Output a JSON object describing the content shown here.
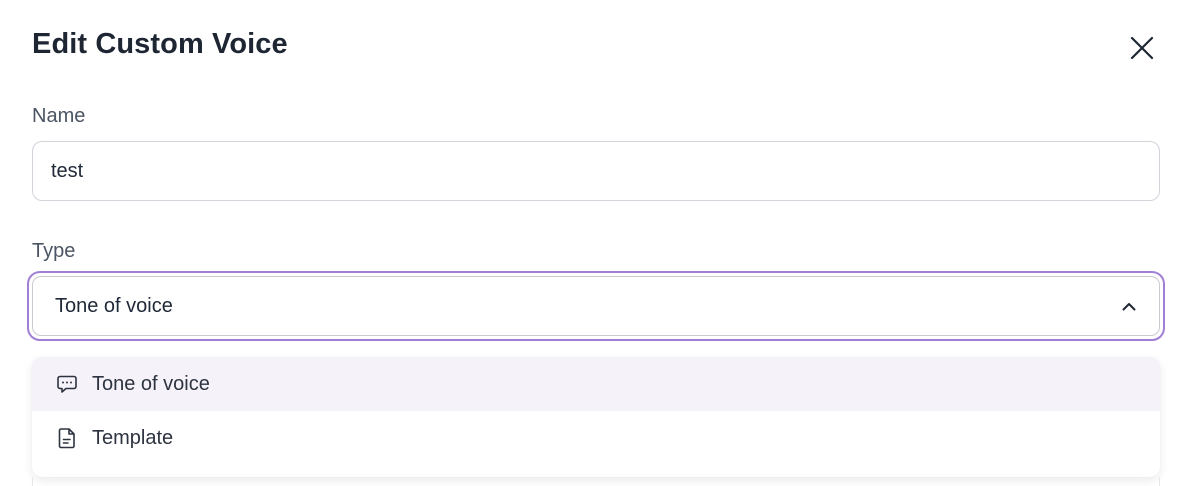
{
  "modal": {
    "title": "Edit Custom Voice",
    "close_icon": "close-icon"
  },
  "name_field": {
    "label": "Name",
    "value": "test"
  },
  "type_field": {
    "label": "Type",
    "selected": "Tone of voice",
    "chevron_icon": "chevron-up-icon",
    "focus_color": "#a07fd4",
    "options": [
      {
        "label": "Tone of voice",
        "icon": "chat-bubble-icon",
        "highlighted": true
      },
      {
        "label": "Template",
        "icon": "document-icon",
        "highlighted": false
      }
    ]
  }
}
